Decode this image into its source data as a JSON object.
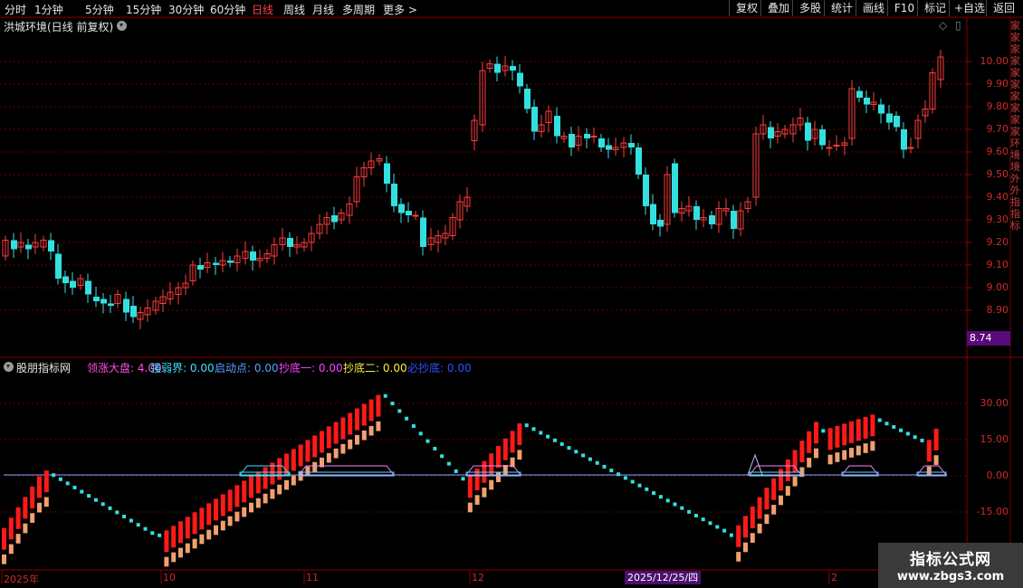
{
  "toolbar": {
    "periods": [
      "分时",
      "1分钟",
      "5分钟",
      "15分钟",
      "30分钟",
      "60分钟",
      "日线",
      "周线",
      "月线",
      "多周期"
    ],
    "active_period": "日线",
    "more_label": "更多 >",
    "buttons": [
      "复权",
      "叠加",
      "多股",
      "统计",
      "画线",
      "F10",
      "标记",
      "+自选",
      "返回"
    ]
  },
  "main_chart": {
    "title": "洪城环境(日线 前复权)",
    "price_ticks": [
      "10.00",
      "9.90",
      "9.80",
      "9.70",
      "9.60",
      "9.50",
      "9.40",
      "9.30",
      "9.20",
      "9.10",
      "9.00",
      "8.90"
    ],
    "current_price": "8.74",
    "right_strip_text": "家家家家家家家家家家环境境外外指指标"
  },
  "indicator": {
    "name": "股朋指标网",
    "params": [
      {
        "label": "领涨大盘",
        "value": "4.00",
        "color": "#ff4de0"
      },
      {
        "label": "强弱界",
        "value": "0.00",
        "color": "#40e0ff"
      },
      {
        "label": "启动点",
        "value": "0.00",
        "color": "#5aa0ff"
      },
      {
        "label": "抄底一",
        "value": "0.00",
        "color": "#ff40ff"
      },
      {
        "label": "抄底二",
        "value": "0.00",
        "color": "#ffee33"
      },
      {
        "label": "必抄底",
        "value": "0.00",
        "color": "#3050ff"
      }
    ],
    "ticks": [
      "30.00",
      "15.00",
      "0.00",
      "-15.00"
    ]
  },
  "dates": [
    "2025年",
    "10",
    "11",
    "12",
    "2"
  ],
  "highlight_date": "2025/12/25/四",
  "watermark": {
    "line1": "指标公式网",
    "line2": "www.zbgs3.com"
  },
  "colors": {
    "up": "#ff3b3b",
    "down": "#33e0e0",
    "grid": "#6b0000",
    "bar": "#ff1a1a",
    "bar2": "#f0a070",
    "dot": "#33e0e0"
  }
}
